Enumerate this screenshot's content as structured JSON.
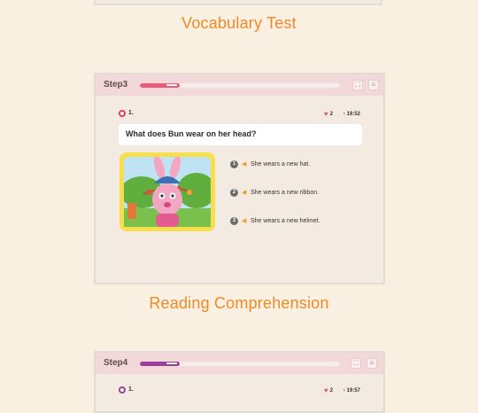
{
  "sections": {
    "vocab_title": "Vocabulary Test",
    "reading_title": "Reading Comprehension"
  },
  "step3": {
    "step_label": "Step3",
    "progress": 0.2,
    "progress_color": "#e95b78",
    "question_number": "1.",
    "hearts": "2",
    "time": "19:52",
    "question": "What does Bun wear on her head?",
    "options": [
      {
        "num": "1",
        "text": "She wears a new hat."
      },
      {
        "num": "2",
        "text": "She wears a new ribbon."
      },
      {
        "num": "3",
        "text": "She wears a new helmet."
      }
    ],
    "header_icons": [
      "fullscreen-icon",
      "menu-icon"
    ]
  },
  "step4": {
    "step_label": "Step4",
    "progress": 0.2,
    "progress_color": "#9a3f9a",
    "question_number": "1.",
    "hearts": "2",
    "time": "19:57"
  },
  "colors": {
    "accent_orange": "#ee8a26",
    "page_bg": "#faf0e2",
    "header_pink": "#f2d8d8",
    "picture_frame": "#f8de4a"
  }
}
